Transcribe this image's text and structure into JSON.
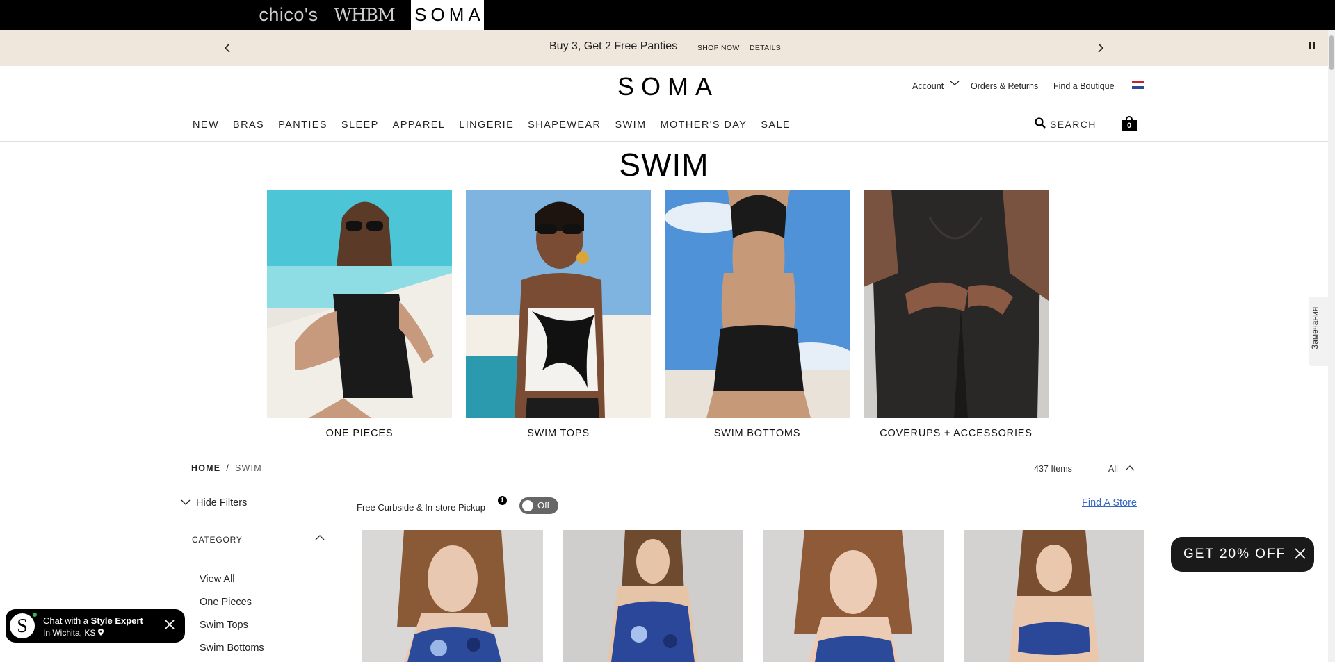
{
  "brand_bar": {
    "brands": [
      "chico's",
      "WHBM",
      "SOMA"
    ]
  },
  "promo": {
    "text": "Buy 3, Get 2 Free Panties",
    "shop_now": "SHOP NOW",
    "details": "DETAILS"
  },
  "header": {
    "logo": "SOMA",
    "account": "Account",
    "orders": "Orders & Returns",
    "boutique": "Find a Boutique",
    "search": "SEARCH",
    "bag_count": "0"
  },
  "nav": {
    "items": [
      "NEW",
      "BRAS",
      "PANTIES",
      "SLEEP",
      "APPAREL",
      "LINGERIE",
      "SHAPEWEAR",
      "SWIM",
      "MOTHER'S DAY",
      "SALE"
    ]
  },
  "page": {
    "title": "SWIM"
  },
  "categories": [
    {
      "label": "ONE PIECES"
    },
    {
      "label": "SWIM TOPS"
    },
    {
      "label": "SWIM BOTTOMS"
    },
    {
      "label": "COVERUPS + ACCESSORIES"
    }
  ],
  "breadcrumb": {
    "home": "HOME",
    "separator": "/",
    "current": "SWIM"
  },
  "listing": {
    "items_count": "437 Items",
    "view": "All"
  },
  "filters": {
    "hide_label": "Hide Filters",
    "pickup_label": "Free Curbside & In-store Pickup",
    "toggle_state": "Off",
    "find_store": "Find A Store",
    "category_header": "CATEGORY",
    "category_links": [
      "View All",
      "One Pieces",
      "Swim Tops",
      "Swim Bottoms"
    ]
  },
  "chat": {
    "prefix": "Chat with a ",
    "bold": "Style Expert",
    "location": "In Wichita, KS"
  },
  "offer": {
    "label": "GET 20% OFF"
  },
  "side_tab": {
    "label": "Замечания"
  },
  "colors": {
    "promo_bg": "#efe6dc",
    "link_blue": "#3567c4",
    "black": "#000000"
  }
}
